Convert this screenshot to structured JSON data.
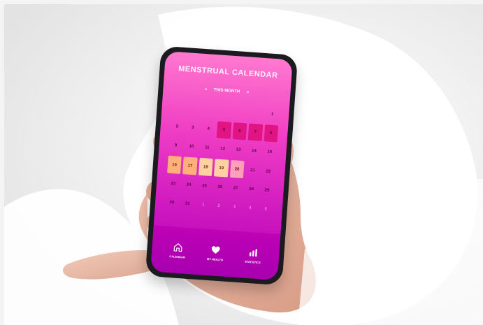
{
  "app": {
    "title": "MENSTRUAL CALENDAR",
    "month": {
      "label": "THIS MONTH",
      "prev_icon": "chevron-left-icon",
      "next_icon": "chevron-right-icon"
    },
    "weekdays": [
      "",
      "",
      "",
      "",
      "",
      "",
      ""
    ],
    "calendar": {
      "cells": [
        {
          "t": "",
          "k": "muted"
        },
        {
          "t": "",
          "k": "muted"
        },
        {
          "t": "",
          "k": "muted"
        },
        {
          "t": "",
          "k": "muted"
        },
        {
          "t": "",
          "k": "muted"
        },
        {
          "t": "",
          "k": "muted"
        },
        {
          "t": "1",
          "k": "normal"
        },
        {
          "t": "2",
          "k": "normal"
        },
        {
          "t": "3",
          "k": "normal"
        },
        {
          "t": "4",
          "k": "normal"
        },
        {
          "t": "5",
          "k": "period"
        },
        {
          "t": "6",
          "k": "period"
        },
        {
          "t": "7",
          "k": "period"
        },
        {
          "t": "8",
          "k": "period"
        },
        {
          "t": "9",
          "k": "normal"
        },
        {
          "t": "10",
          "k": "normal"
        },
        {
          "t": "11",
          "k": "normal"
        },
        {
          "t": "12",
          "k": "normal"
        },
        {
          "t": "13",
          "k": "normal"
        },
        {
          "t": "14",
          "k": "normal"
        },
        {
          "t": "15",
          "k": "normal"
        },
        {
          "t": "16",
          "k": "fertile"
        },
        {
          "t": "17",
          "k": "fertile"
        },
        {
          "t": "18",
          "k": "fertile2"
        },
        {
          "t": "19",
          "k": "fertile2"
        },
        {
          "t": "20",
          "k": "ovulation"
        },
        {
          "t": "21",
          "k": "normal"
        },
        {
          "t": "22",
          "k": "normal"
        },
        {
          "t": "23",
          "k": "normal"
        },
        {
          "t": "24",
          "k": "normal"
        },
        {
          "t": "25",
          "k": "normal"
        },
        {
          "t": "26",
          "k": "normal"
        },
        {
          "t": "27",
          "k": "normal"
        },
        {
          "t": "28",
          "k": "normal"
        },
        {
          "t": "29",
          "k": "normal"
        },
        {
          "t": "30",
          "k": "normal"
        },
        {
          "t": "31",
          "k": "normal"
        },
        {
          "t": "1",
          "k": "muted"
        },
        {
          "t": "2",
          "k": "muted"
        },
        {
          "t": "3",
          "k": "muted"
        },
        {
          "t": "4",
          "k": "muted"
        },
        {
          "t": "5",
          "k": "muted"
        }
      ]
    },
    "nav": [
      {
        "label": "CALENDAR",
        "icon": "home-icon"
      },
      {
        "label": "MY HEALTH",
        "icon": "heart-icon"
      },
      {
        "label": "STATISTICS",
        "icon": "bar-chart-icon"
      }
    ]
  },
  "colors": {
    "screen_top": "#ff79cf",
    "screen_bottom": "#b300b7",
    "period": "#e11484",
    "fertile": "#ffb07a",
    "ovulation": "#ff9fb8"
  }
}
